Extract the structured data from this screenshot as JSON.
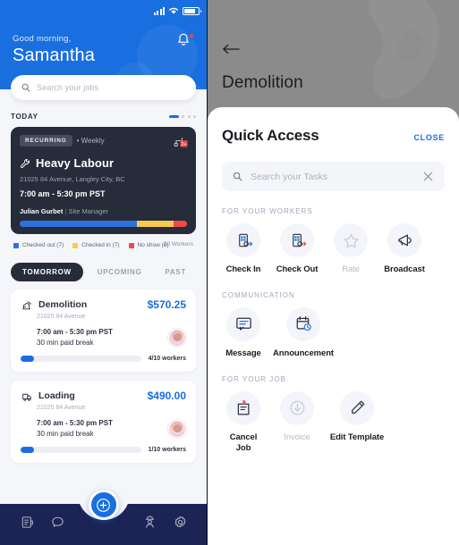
{
  "left": {
    "status_bar": {
      "signal_icon": "cellular-signal-icon",
      "wifi_icon": "wifi-icon",
      "battery_icon": "battery-icon"
    },
    "greeting": "Good morning,",
    "username": "Samantha",
    "notification_icon": "bell-icon",
    "search": {
      "icon": "search-icon",
      "placeholder": "Search your jobs"
    },
    "today_label": "TODAY",
    "featured_job": {
      "badge": "RECURRING",
      "frequency": "• Weekly",
      "corner_icon": "shift-alert-icon",
      "title_icon": "wrench-icon",
      "title": "Heavy Labour",
      "address": "21025 84 Avenue, Langley City, BC",
      "time": "7:00 am - 5:30 pm PST",
      "manager_name": "Julian Gurbet",
      "manager_sep": "|",
      "manager_role": "Site Manager",
      "bar_segments": [
        {
          "color": "#2d72e0",
          "pct": 70
        },
        {
          "color": "#fbc94e",
          "pct": 22
        },
        {
          "color": "#ef4a48",
          "pct": 8
        }
      ],
      "legend": [
        {
          "color": "#2d72e0",
          "label": "Checked out (7)"
        },
        {
          "color": "#fbc94e",
          "label": "Checked in (7)"
        },
        {
          "color": "#ef4a48",
          "label": "No show (6)"
        }
      ],
      "total_workers": "20 Workers"
    },
    "tabs": [
      {
        "label": "TOMORROW",
        "active": true
      },
      {
        "label": "UPCOMING",
        "active": false
      },
      {
        "label": "PAST",
        "active": false
      }
    ],
    "jobs": [
      {
        "icon": "demolition-icon",
        "name": "Demolition",
        "price": "$570.25",
        "address": "21025 84 Avenue",
        "time": "7:00 am - 5:30 pm PST",
        "break": "30 min paid break",
        "progress_pct": 11,
        "count": "4/10 workers",
        "avatar": "worker-avatar"
      },
      {
        "icon": "loading-icon",
        "name": "Loading",
        "price": "$490.00",
        "address": "21025 84 Avenue",
        "time": "7:00 am - 5:30 pm PST",
        "break": "30 min paid break",
        "progress_pct": 11,
        "count": "1/10 workers",
        "avatar": "worker-avatar"
      }
    ],
    "bottom_nav": [
      {
        "icon": "jobs-icon"
      },
      {
        "icon": "chat-icon"
      },
      {
        "icon": "worker-icon"
      },
      {
        "icon": "settings-icon"
      }
    ],
    "fab_icon": "add-circle-icon"
  },
  "right": {
    "back_icon": "back-arrow-icon",
    "page_title": "Demolition",
    "sheet": {
      "title": "Quick Access",
      "close_label": "CLOSE",
      "search": {
        "icon": "search-icon",
        "placeholder": "Search your Tasks",
        "clear_icon": "close-icon"
      },
      "groups": [
        {
          "label": "FOR YOUR WORKERS",
          "tiles": [
            {
              "icon": "check-in-icon",
              "label": "Check In",
              "disabled": false
            },
            {
              "icon": "check-out-icon",
              "label": "Check Out",
              "disabled": false
            },
            {
              "icon": "star-icon",
              "label": "Rate",
              "disabled": true
            },
            {
              "icon": "megaphone-icon",
              "label": "Broadcast",
              "disabled": false
            }
          ]
        },
        {
          "label": "COMMUNICATION",
          "tiles": [
            {
              "icon": "message-icon",
              "label": "Message",
              "disabled": false
            },
            {
              "icon": "announcement-calendar-icon",
              "label": "Announcement",
              "disabled": false
            }
          ]
        },
        {
          "label": "FOR YOUR JOB",
          "tiles": [
            {
              "icon": "cancel-job-icon",
              "label": "Cancel Job",
              "disabled": false
            },
            {
              "icon": "invoice-download-icon",
              "label": "Invoice",
              "disabled": true
            },
            {
              "icon": "pencil-icon",
              "label": "Edit Template",
              "disabled": false
            }
          ]
        }
      ]
    }
  },
  "colors": {
    "primary": "#1a6fe0",
    "dark": "#262c3a",
    "navy": "#1b2455",
    "warning": "#fbc94e",
    "danger": "#ef4a48"
  }
}
